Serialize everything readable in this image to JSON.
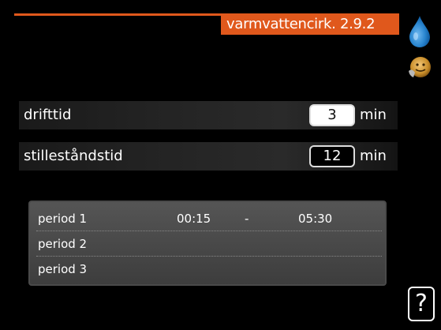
{
  "header": {
    "title": "varmvattencirk. 2.9.2",
    "accent_color": "#e0581c"
  },
  "icons": {
    "hot_water": "water-drop-icon",
    "comfort": "smiley-face-icon",
    "help": "help-icon"
  },
  "settings": [
    {
      "label": "drifttid",
      "value": "3",
      "unit": "min",
      "state": "selected"
    },
    {
      "label": "stilleståndstid",
      "value": "12",
      "unit": "min",
      "state": "normal"
    }
  ],
  "periods": [
    {
      "label": "period 1",
      "start": "00:15",
      "separator": "-",
      "end": "05:30"
    },
    {
      "label": "period 2",
      "start": "",
      "separator": "",
      "end": ""
    },
    {
      "label": "period 3",
      "start": "",
      "separator": "",
      "end": ""
    }
  ],
  "help": {
    "label": "?"
  }
}
